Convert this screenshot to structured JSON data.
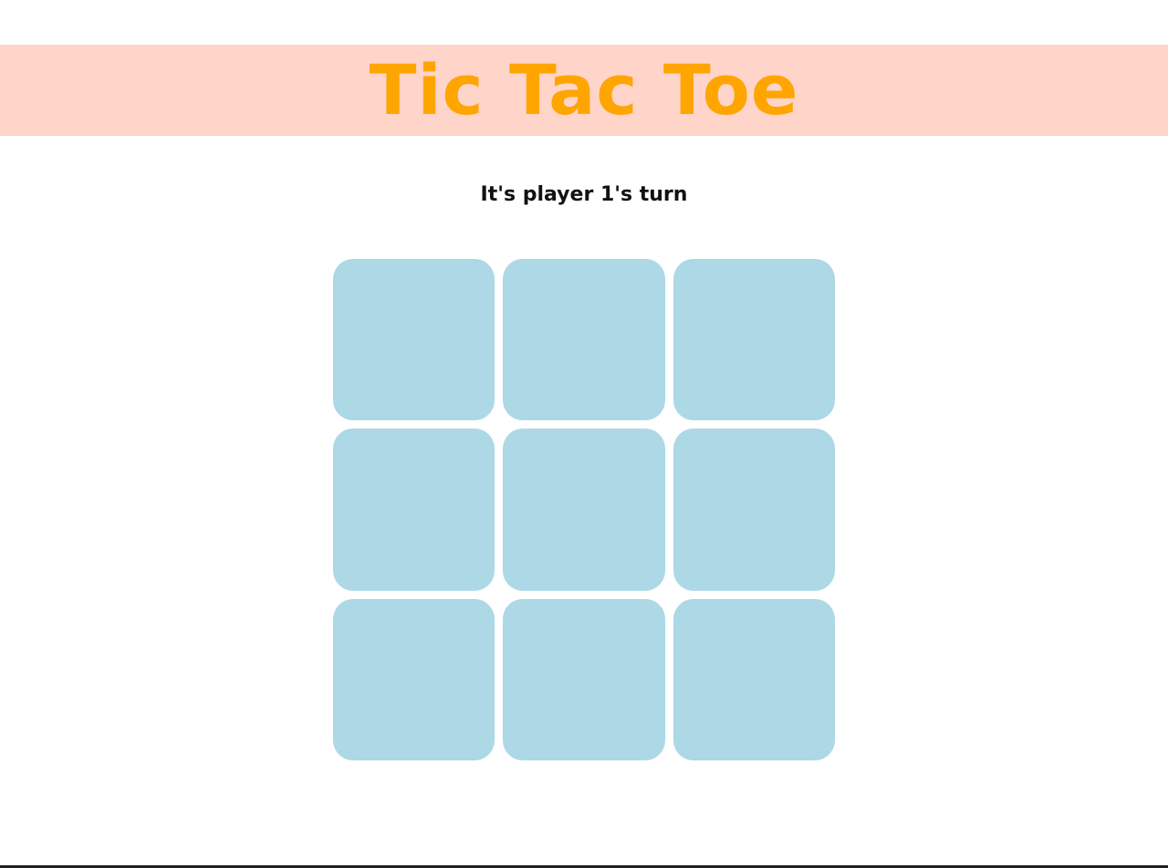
{
  "header": {
    "title": "Tic Tac Toe"
  },
  "status": {
    "text": "It's player 1's turn"
  },
  "board": {
    "cells": [
      "",
      "",
      "",
      "",
      "",
      "",
      "",
      "",
      ""
    ]
  },
  "colors": {
    "header_background": "#ffd4c9",
    "title": "#ffa500",
    "cell": "#add8e6",
    "status_text": "#111111"
  }
}
